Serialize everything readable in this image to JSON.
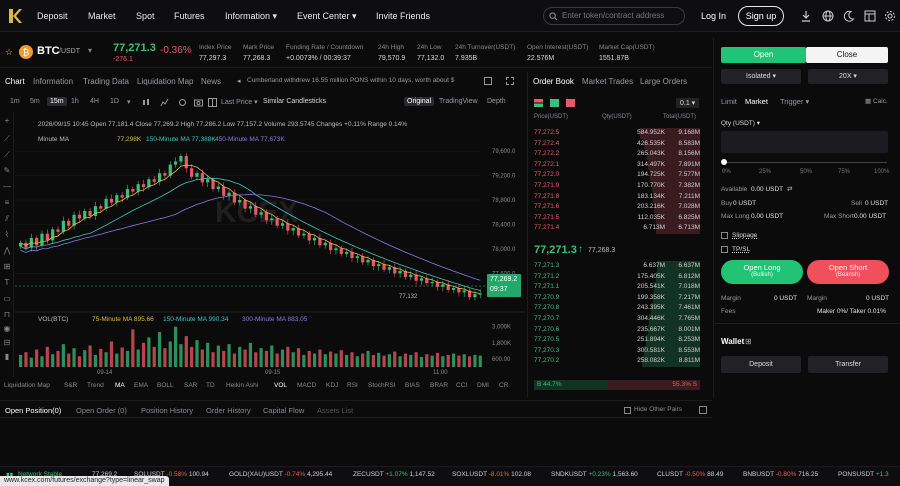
{
  "nav": {
    "items": [
      "Deposit",
      "Market",
      "Spot",
      "Futures",
      "Information ▾",
      "Event Center ▾",
      "Invite Friends"
    ],
    "search_placeholder": "Enter token/contract address",
    "login": "Log In",
    "signup": "Sign up"
  },
  "ticker": {
    "symbol": "BTC",
    "quote": "/USDT",
    "price": "77,271.3",
    "change_pct": "-0.36%",
    "change_abs": "-276.1",
    "stats": [
      {
        "label": "Index Price",
        "value": "77,297.3"
      },
      {
        "label": "Mark Price",
        "value": "77,268.3"
      },
      {
        "label": "Funding Rate / Countdown",
        "value": "+0.0073% / 00:39:37"
      },
      {
        "label": "24h High",
        "value": "79,570.9"
      },
      {
        "label": "24h Low",
        "value": "77,132.0"
      },
      {
        "label": "24h Turnover(USDT)",
        "value": "7.935B"
      },
      {
        "label": "Open Interest(USDT)",
        "value": "22.576M"
      },
      {
        "label": "Market Cap(USDT)",
        "value": "1551.87B"
      }
    ]
  },
  "chart_tabs": [
    "Chart",
    "Information",
    "Trading Data",
    "Liquidation Map",
    "News"
  ],
  "notice": "Cumberland withdrew 16.55 million PONS within 10 days, worth about $",
  "timeframes": [
    "1m",
    "5m",
    "15m",
    "1h",
    "4H",
    "1D"
  ],
  "last_price_label": "Last Price ▾",
  "similar_label": "Similar Candlesticks",
  "view_tabs": [
    "Original",
    "TradingView",
    "Depth"
  ],
  "chart_header": {
    "ohlc": "2026/09/15 10:45 Open 77,181.4 Close 77,269.2 High 77,286.2 Low 77,157.2 Volume 293.5745 Changes +0.11% Range 0.14%",
    "ma_line": "Minute MA",
    "ma_values": [
      "77,298K",
      "150-Minute MA 77,388K",
      "450-Minute MA 77,673K"
    ],
    "vol_line": "VOL(BTC)",
    "vol_values": [
      "75-Minute MA 895.66",
      "150-Minute MA 990.34",
      "300-Minute MA 883.05"
    ]
  },
  "price_badge": {
    "price": "77,269.2",
    "countdown": "09:37"
  },
  "low_marker": "77,132",
  "indicators": [
    "Liquidation Map",
    "S&R",
    "Trend",
    "MA",
    "EMA",
    "BOLL",
    "SAR",
    "TD",
    "Heikin Ashi",
    "VOL",
    "MACD",
    "KDJ",
    "RSI",
    "StochRSI",
    "BIAS",
    "BRAR",
    "CCI",
    "DMI",
    "CR"
  ],
  "bottom_tabs": [
    "Open Position(0)",
    "Open Order (0)",
    "Position History",
    "Order History",
    "Capital Flow",
    "Assets List"
  ],
  "hide_other_pairs": "Hide Other Pairs",
  "orderbook": {
    "tabs": [
      "Order Book",
      "Market Trades",
      "Large Orders"
    ],
    "precision": "0.1 ▾",
    "headers": [
      "Price(USDT)",
      "Qty(USDT)",
      "Total(USDT)"
    ],
    "asks": [
      {
        "p": "77,272.5",
        "q": "584.952K",
        "t": "9.168M",
        "d": 1.0
      },
      {
        "p": "77,272.4",
        "q": "426.535K",
        "t": "8.583M",
        "d": 0.93
      },
      {
        "p": "77,272.2",
        "q": "265.043K",
        "t": "8.156M",
        "d": 0.89
      },
      {
        "p": "77,272.1",
        "q": "314.497K",
        "t": "7.891M",
        "d": 0.86
      },
      {
        "p": "77,272.0",
        "q": "194.725K",
        "t": "7.577M",
        "d": 0.83
      },
      {
        "p": "77,271.9",
        "q": "170.770K",
        "t": "7.382M",
        "d": 0.8
      },
      {
        "p": "77,271.8",
        "q": "183.134K",
        "t": "7.211M",
        "d": 0.79
      },
      {
        "p": "77,271.6",
        "q": "203.216K",
        "t": "7.028M",
        "d": 0.77
      },
      {
        "p": "77,271.5",
        "q": "112.035K",
        "t": "6.825M",
        "d": 0.74
      },
      {
        "p": "77,271.4",
        "q": "6.713M",
        "t": "6.713M",
        "d": 0.73
      }
    ],
    "mid_price": "77,271.3",
    "mid_arrow": "↑",
    "mid_mark": "77,268.3",
    "bids": [
      {
        "p": "77,271.3",
        "q": "6.637M",
        "t": "6.637M",
        "d": 0.72
      },
      {
        "p": "77,271.2",
        "q": "175.405K",
        "t": "6.812M",
        "d": 0.74
      },
      {
        "p": "77,271.1",
        "q": "205.541K",
        "t": "7.018M",
        "d": 0.77
      },
      {
        "p": "77,270.9",
        "q": "199.358K",
        "t": "7.217M",
        "d": 0.79
      },
      {
        "p": "77,270.8",
        "q": "243.395K",
        "t": "7.461M",
        "d": 0.81
      },
      {
        "p": "77,270.7",
        "q": "304.446K",
        "t": "7.765M",
        "d": 0.85
      },
      {
        "p": "77,270.6",
        "q": "235.667K",
        "t": "8.001M",
        "d": 0.87
      },
      {
        "p": "77,270.5",
        "q": "251.894K",
        "t": "8.253M",
        "d": 0.9
      },
      {
        "p": "77,270.3",
        "q": "300.581K",
        "t": "8.553M",
        "d": 0.93
      },
      {
        "p": "77,270.2",
        "q": "258.082K",
        "t": "8.811M",
        "d": 0.96
      }
    ],
    "buy_ratio": "B 44.7%",
    "sell_ratio": "55.3% S",
    "buy_ratio_value": 44.7
  },
  "trade": {
    "open": "Open",
    "close": "Close",
    "margin_mode": "Isolated ▾",
    "leverage": "20X ▾",
    "order_types": [
      "Limit",
      "Market",
      "Trigger ▾"
    ],
    "calc": "Calc.",
    "qty_label": "Qty (USDT) ▾",
    "slider_marks": [
      "0%",
      "25%",
      "50%",
      "75%",
      "100%"
    ],
    "available_label": "Available",
    "available_value": "0.00 USDT",
    "buy_label": "Buy",
    "buy_value": "0 USDT",
    "sell_label": "Sell",
    "sell_value": "0 USDT",
    "maxlong_label": "Max Long",
    "maxlong_value": "0.00 USDT",
    "maxshort_label": "Max Short",
    "maxshort_value": "0.00 USDT",
    "slippage": "Slippage",
    "tpsl": "TP/SL",
    "open_long": "Open Long",
    "open_long_sub": "(Bullish)",
    "open_short": "Open Short",
    "open_short_sub": "(Bearish)",
    "margin_label": "Margin",
    "margin_value": "0 USDT",
    "margin2_label": "Margin",
    "margin2_value": "0 USDT",
    "fees_label": "Fees",
    "fees_value": "Maker 0%/ Taker 0.01%",
    "wallet": "Wallet",
    "deposit": "Deposit",
    "transfer": "Transfer"
  },
  "statusbar": [
    {
      "label": "Network Stable",
      "value": "",
      "chg": ""
    },
    {
      "label": "",
      "value": "77,269.2",
      "chg": ""
    },
    {
      "label": "SOLUSDT",
      "value": "100.94",
      "chg": "-0.58%"
    },
    {
      "label": "GOLD(XAU)USDT",
      "value": "4,295.44",
      "chg": "-0.74%"
    },
    {
      "label": "ZECUSDT",
      "value": "1,147.52",
      "chg": "+1.07%"
    },
    {
      "label": "SOXLUSDT",
      "value": "102.08",
      "chg": "-8.01%"
    },
    {
      "label": "SNDKUSDT",
      "value": "1,563.60",
      "chg": "+0.23%"
    },
    {
      "label": "CLUSDT",
      "value": "88.49",
      "chg": "-0.50%"
    },
    {
      "label": "BNBUSDT",
      "value": "716.25",
      "chg": "-0.80%"
    },
    {
      "label": "PONSUSDT",
      "value": "",
      "chg": "+1.3"
    }
  ],
  "url": "www.kcex.com/futures/exchange?type=linear_swap",
  "colors": {
    "up": "#3cbf7b",
    "down": "#e85a63",
    "accent": "#21c474",
    "bg": "#0b0b0c"
  },
  "chart_data": {
    "type": "candlestick",
    "price_axis": [
      "79,600.0",
      "79,200.0",
      "78,800.0",
      "78,400.0",
      "78,000.0",
      "77,600.0"
    ],
    "price_range": [
      77050,
      79750
    ],
    "x_labels": [
      "09-14",
      "09-15",
      "11:00"
    ],
    "volume_axis": [
      "3,000K",
      "1,800K",
      "600.00"
    ],
    "close_series": [
      78100,
      78020,
      78180,
      78060,
      78250,
      78140,
      78320,
      78280,
      78460,
      78380,
      78560,
      78500,
      78620,
      78540,
      78700,
      78660,
      78820,
      78760,
      78880,
      78840,
      78980,
      78940,
      79060,
      79010,
      79140,
      79100,
      79240,
      79200,
      79380,
      79430,
      79520,
      79320,
      79180,
      79240,
      79090,
      79140,
      78980,
      79020,
      78870,
      78920,
      78760,
      78800,
      78660,
      78700,
      78560,
      78600,
      78470,
      78500,
      78380,
      78420,
      78300,
      78340,
      78220,
      78250,
      78140,
      78180,
      78060,
      78100,
      77980,
      78010,
      77920,
      77950,
      77850,
      77880,
      77780,
      77820,
      77720,
      77750,
      77660,
      77700,
      77600,
      77640,
      77540,
      77580,
      77480,
      77520,
      77440,
      77460,
      77380,
      77420,
      77330,
      77360,
      77290,
      77320,
      77210,
      77260,
      77269
    ],
    "volume_values": [
      900,
      1100,
      700,
      1300,
      800,
      1500,
      950,
      1200,
      1700,
      1000,
      1400,
      800,
      1250,
      1600,
      900,
      1350,
      1100,
      1900,
      1000,
      1450,
      1200,
      2800,
      1300,
      1800,
      2200,
      1500,
      2600,
      1400,
      1900,
      3000,
      1700,
      2300,
      1500,
      2000,
      1300,
      1800,
      1100,
      1600,
      1200,
      1700,
      1000,
      1500,
      1300,
      1800,
      1100,
      1400,
      1200,
      1600,
      1000,
      1300,
      1500,
      1100,
      1400,
      900,
      1200,
      1000,
      1300,
      950,
      1150,
      1000,
      1250,
      900,
      1100,
      800,
      1000,
      1200,
      900,
      1050,
      850,
      950,
      1150,
      800,
      1000,
      900,
      1100,
      750,
      950,
      850,
      1050,
      800,
      900,
      1000,
      850,
      950,
      800,
      900,
      850
    ],
    "ma_series": [
      {
        "name": "Minute MA",
        "color": "#e5b83a"
      },
      {
        "name": "150-Minute MA",
        "color": "#3fc7c1"
      },
      {
        "name": "450-Minute MA",
        "color": "#8a7ae6"
      }
    ]
  }
}
